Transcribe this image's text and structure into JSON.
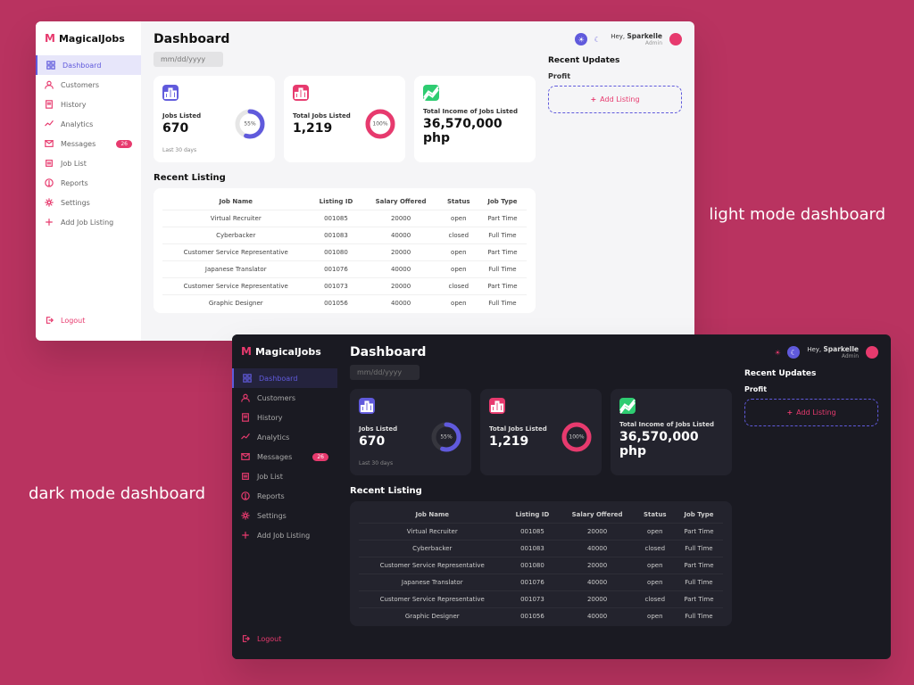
{
  "captions": {
    "light": "light mode dashboard",
    "dark": "dark mode dashboard"
  },
  "brand": "MagicalJobs",
  "page_title": "Dashboard",
  "date_placeholder": "mm/dd/yyyy",
  "sidebar": {
    "items": [
      {
        "label": "Dashboard",
        "icon": "grid",
        "active": true
      },
      {
        "label": "Customers",
        "icon": "user"
      },
      {
        "label": "History",
        "icon": "receipt"
      },
      {
        "label": "Analytics",
        "icon": "chart"
      },
      {
        "label": "Messages",
        "icon": "mail",
        "badge": "26"
      },
      {
        "label": "Job List",
        "icon": "list"
      },
      {
        "label": "Reports",
        "icon": "alert"
      },
      {
        "label": "Settings",
        "icon": "gear"
      },
      {
        "label": "Add Job Listing",
        "icon": "plus"
      }
    ],
    "logout": "Logout"
  },
  "cards": [
    {
      "icon": "bar",
      "color": "blue",
      "label": "Jobs Listed",
      "value": "670",
      "pct": "55%",
      "sub": "Last 30 days"
    },
    {
      "icon": "bar",
      "color": "pink",
      "label": "Total Jobs Listed",
      "value": "1,219",
      "pct": "100%"
    },
    {
      "icon": "trend",
      "color": "green",
      "label": "Total Income of Jobs Listed",
      "value": "36,570,000 php"
    }
  ],
  "listing": {
    "title": "Recent Listing",
    "cols": [
      "Job Name",
      "Listing ID",
      "Salary Offered",
      "Status",
      "Job Type"
    ],
    "rows": [
      [
        "Virtual Recruiter",
        "001085",
        "20000",
        "open",
        "Part Time"
      ],
      [
        "Cyberbacker",
        "001083",
        "40000",
        "closed",
        "Full Time"
      ],
      [
        "Customer Service Representative",
        "001080",
        "20000",
        "open",
        "Part Time"
      ],
      [
        "Japanese Translator",
        "001076",
        "40000",
        "open",
        "Full Time"
      ],
      [
        "Customer Service Representative",
        "001073",
        "20000",
        "closed",
        "Part Time"
      ],
      [
        "Graphic Designer",
        "001056",
        "40000",
        "open",
        "Full Time"
      ]
    ]
  },
  "right": {
    "greeting": "Hey,",
    "user": "Sparkelle",
    "role": "Admin",
    "updates": "Recent Updates",
    "profit": "Profit",
    "add": "Add Listing"
  }
}
